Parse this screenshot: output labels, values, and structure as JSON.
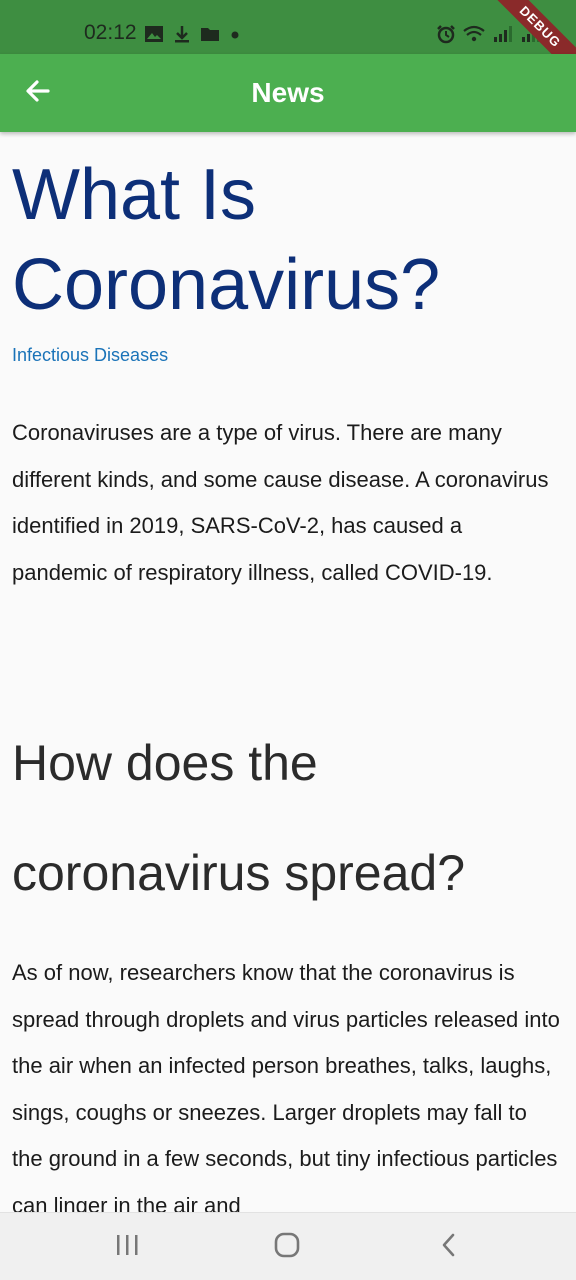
{
  "status_bar": {
    "time": "02:12",
    "left_icons": [
      "image-icon",
      "download-icon",
      "folder-icon",
      "dot-icon"
    ],
    "right_icons": [
      "alarm-icon",
      "wifi-icon",
      "signal-icon",
      "signal-icon"
    ],
    "debug_label": "DEBUG",
    "background_color": "#3e8e41"
  },
  "app_bar": {
    "title": "News",
    "back_icon": "arrow-left-icon",
    "background_color": "#4caf50"
  },
  "article": {
    "title": "What Is Coronavirus?",
    "category": "Infectious Diseases",
    "paragraph_1": "Coronaviruses are a type of virus. There are many different kinds, and some cause disease. A coronavirus identified in 2019, SARS-CoV-2, has caused a pandemic of respiratory illness, called COVID-19.",
    "section_heading": "How does the coronavirus spread?",
    "paragraph_2": "As of now, researchers know that the coronavirus is spread through droplets and virus particles released into the air when an infected person breathes, talks, laughs, sings, coughs or sneezes. Larger droplets may fall to the ground in a few seconds, but tiny infectious particles can linger in the air and",
    "title_color": "#0d2f78",
    "category_color": "#1a73b8"
  },
  "nav_bar": {
    "buttons": [
      "recents-icon",
      "home-icon",
      "back-icon"
    ]
  }
}
